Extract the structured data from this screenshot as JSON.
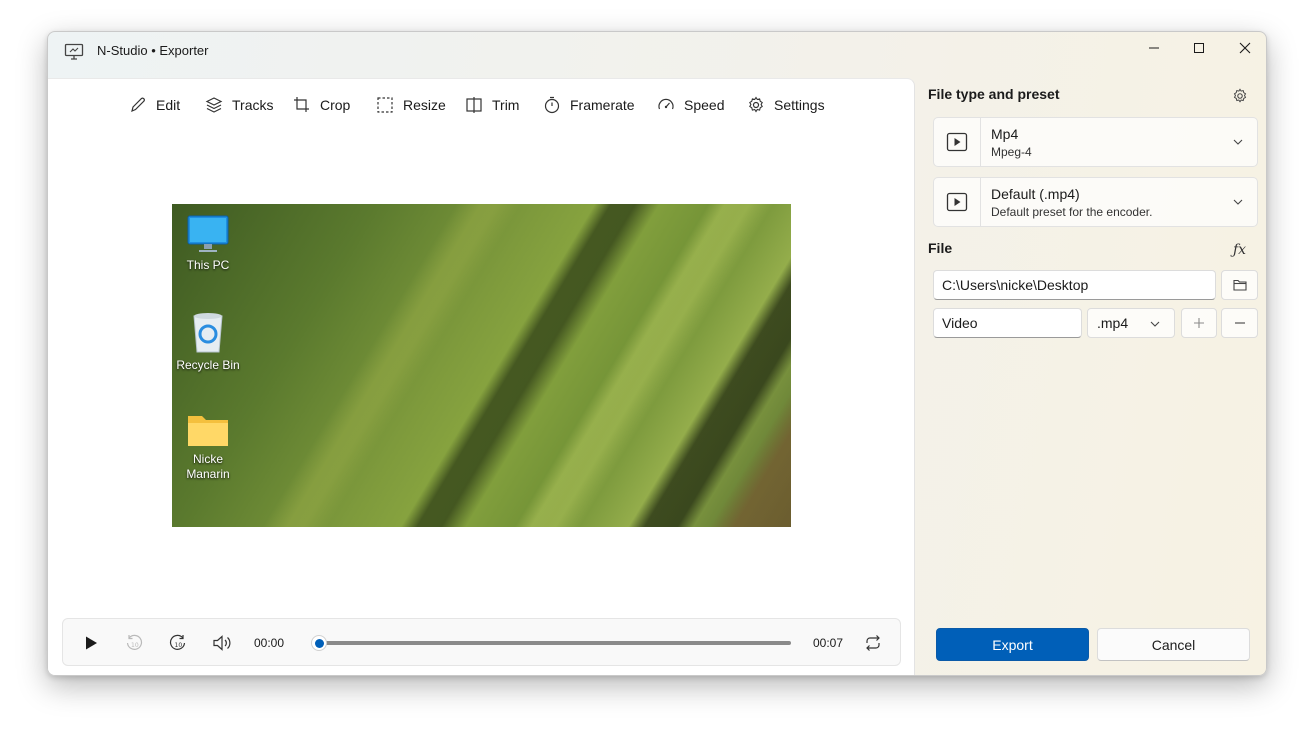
{
  "window": {
    "title": "N-Studio • Exporter"
  },
  "toolbar": {
    "items": [
      {
        "label": "Edit",
        "icon": "pencil-icon"
      },
      {
        "label": "Tracks",
        "icon": "layers-icon"
      },
      {
        "label": "Crop",
        "icon": "crop-icon"
      },
      {
        "label": "Resize",
        "icon": "resize-icon"
      },
      {
        "label": "Trim",
        "icon": "trim-icon"
      },
      {
        "label": "Framerate",
        "icon": "timer-icon"
      },
      {
        "label": "Speed",
        "icon": "speedometer-icon"
      },
      {
        "label": "Settings",
        "icon": "gear-icon"
      }
    ]
  },
  "preview": {
    "desktop_icons": [
      {
        "label": "This PC",
        "icon": "monitor-icon"
      },
      {
        "label": "Recycle Bin",
        "icon": "recycle-bin-icon"
      },
      {
        "label": "Nicke Manarin",
        "icon": "folder-icon"
      }
    ]
  },
  "player": {
    "current_time": "00:00",
    "total_time": "00:07",
    "progress": 0
  },
  "side": {
    "file_type_title": "File type and preset",
    "file_type": {
      "name": "Mp4",
      "description": "Mpeg-4"
    },
    "preset": {
      "name": "Default (.mp4)",
      "description": "Default preset for the encoder."
    },
    "file_title": "File",
    "folder_path": "C:\\Users\\nicke\\Desktop",
    "file_name": "Video",
    "extension": ".mp4",
    "export_label": "Export",
    "cancel_label": "Cancel"
  },
  "colors": {
    "accent": "#005fb8"
  }
}
